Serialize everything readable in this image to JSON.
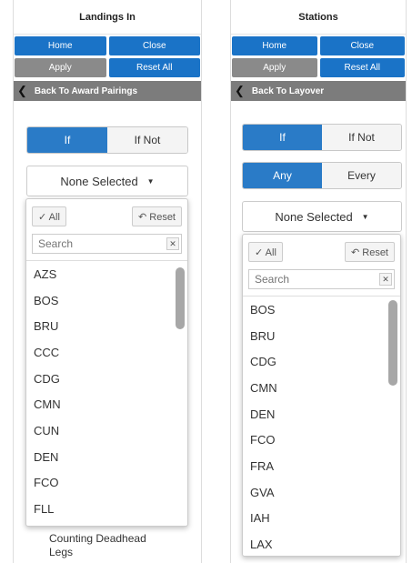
{
  "left": {
    "title": "Landings In",
    "buttons": {
      "home": "Home",
      "close": "Close",
      "apply": "Apply",
      "reset_all": "Reset All"
    },
    "back_label": "Back To Award Pairings",
    "toggle": {
      "if": "If",
      "if_not": "If Not"
    },
    "multiselect": {
      "value": "None Selected"
    },
    "dropdown": {
      "all_label": "✓ All",
      "reset_label": "↶ Reset",
      "search_placeholder": "Search",
      "items": [
        "AZS",
        "BOS",
        "BRU",
        "CCC",
        "CDG",
        "CMN",
        "CUN",
        "DEN",
        "FCO",
        "FLL"
      ]
    },
    "deadhead_label": "Counting Deadhead Legs"
  },
  "right": {
    "title": "Stations",
    "buttons": {
      "home": "Home",
      "close": "Close",
      "apply": "Apply",
      "reset_all": "Reset All"
    },
    "back_label": "Back To Layover",
    "toggle": {
      "if": "If",
      "if_not": "If Not"
    },
    "toggle2": {
      "any": "Any",
      "every": "Every"
    },
    "multiselect": {
      "value": "None Selected"
    },
    "dropdown": {
      "all_label": "✓ All",
      "reset_label": "↶ Reset",
      "search_placeholder": "Search",
      "items": [
        "BOS",
        "BRU",
        "CDG",
        "CMN",
        "DEN",
        "FCO",
        "FRA",
        "GVA",
        "IAH",
        "LAX"
      ]
    }
  },
  "colors": {
    "primary": "#1a73c7",
    "toggle_active": "#2a7bc7",
    "disabled": "#8a8a8a",
    "back_bar": "#7c7c7c"
  }
}
